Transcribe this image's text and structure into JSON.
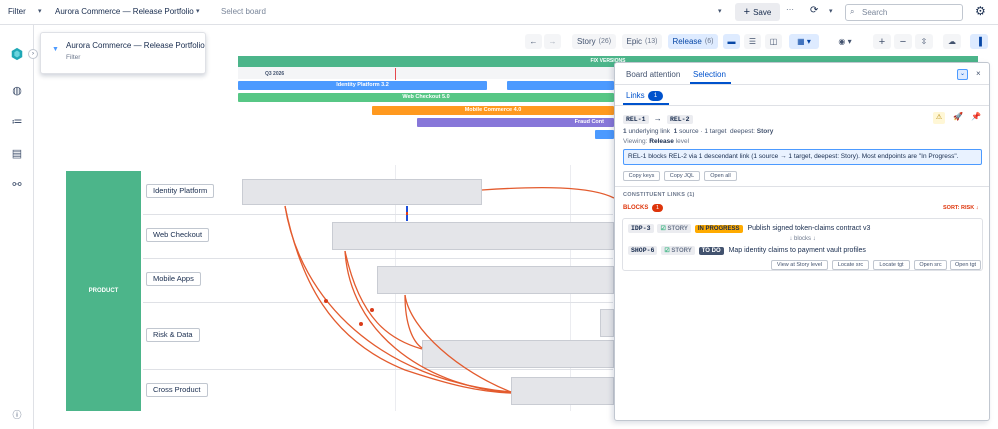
{
  "topbar": {
    "filter_label": "Filter",
    "board_name": "Aurora Commerce — Release Portfolio",
    "select_board_placeholder": "Select board",
    "save_label": "Save",
    "search_placeholder": "Search"
  },
  "popup": {
    "title": "Aurora Commerce — Release Portfolio",
    "subtitle": "Filter"
  },
  "view_toolbar": {
    "story_label": "Story",
    "story_count": "(26)",
    "epic_label": "Epic",
    "epic_count": "(13)",
    "release_label": "Release",
    "release_count": "(6)"
  },
  "timeline": {
    "fix_versions": "FIX VERSIONS",
    "quarter": "Q3 2026",
    "releases": [
      {
        "name": "Identity Platform 3.2",
        "color": "#4c9aff"
      },
      {
        "name": "Web Checkout 5.0",
        "color": "#57c785"
      },
      {
        "name": "Mobile Commerce 4.0",
        "color": "#ff991f"
      },
      {
        "name": "Fraud Cont",
        "color": "#8777d9"
      }
    ]
  },
  "lanes": {
    "group": "PRODUCT",
    "items": [
      "Identity Platform",
      "Web Checkout",
      "Mobile Apps",
      "Risk & Data",
      "Cross Product"
    ]
  },
  "panel": {
    "tab_attention": "Board attention",
    "tab_selection": "Selection",
    "subtab_links": "Links",
    "links_count": "1",
    "from_key": "REL-1",
    "arrow": "→",
    "to_key": "REL-2",
    "stats": {
      "underlying_num": "1",
      "underlying_label": "underlying link",
      "source_num": "1",
      "source_label": "source",
      "target_label": "· 1 target",
      "deepest_label": "deepest:",
      "deepest_value": "Story"
    },
    "viewing_label": "Viewing:",
    "viewing_value": "Release",
    "viewing_suffix": "level",
    "summary": "REL-1 blocks REL-2 via 1 descendant link (1 source → 1 target, deepest: Story). Most endpoints are \"In Progress\".",
    "actions": [
      "Copy keys",
      "Copy JQL",
      "Open all"
    ],
    "constituent_header": "CONSTITUENT LINKS (1)",
    "blocks_label": "BLOCKS",
    "blocks_count": "1",
    "sort_label": "SORT: RISK ↓",
    "source": {
      "key": "IDP-3",
      "type": "STORY",
      "status": "IN PROGRESS",
      "summary": "Publish signed token-claims contract v3"
    },
    "relation": "↓ blocks ↓",
    "target": {
      "key": "SHOP-6",
      "type": "STORY",
      "status": "TO DO",
      "summary": "Map identity claims to payment vault profiles"
    },
    "link_actions": [
      "View at Story level",
      "Locate src",
      "Locate tgt",
      "Open src",
      "Open tgt"
    ]
  }
}
